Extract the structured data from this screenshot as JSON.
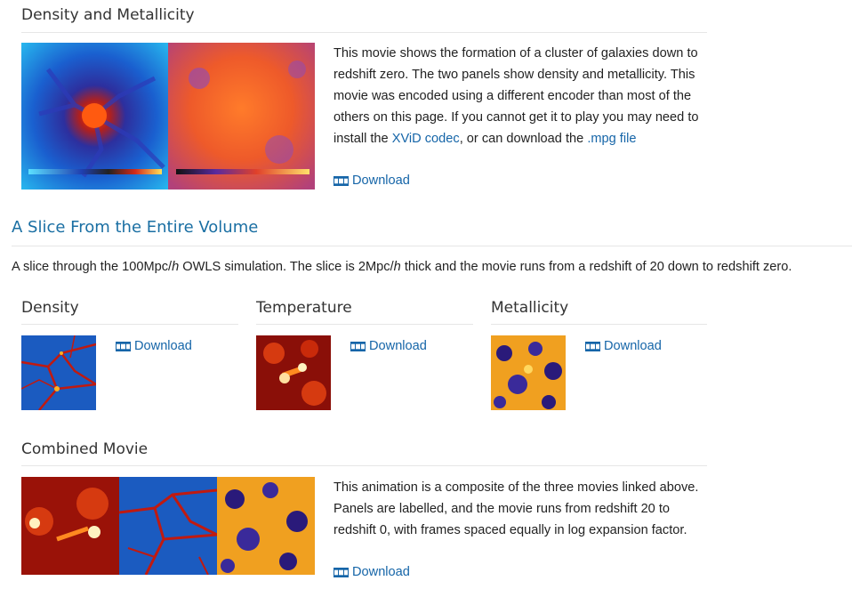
{
  "section1": {
    "title": "Density and Metallicity",
    "para_1": "This movie shows the formation of a cluster of galaxies down to redshift zero. The two panels show density and metallicity. This movie was encoded using a different encoder than most of the others on this page. If you cannot get it to play you may need to install the ",
    "codec_link": "XViD codec",
    "para_2": ", or can download the ",
    "mpg_link": ".mpg file",
    "download": "Download",
    "film-icon": "film-icon"
  },
  "section2": {
    "title": "A Slice From the Entire Volume",
    "intro_a": "A slice through the 100Mpc/",
    "intro_h1": "h",
    "intro_b": " OWLS simulation. The slice is 2Mpc/",
    "intro_h2": "h",
    "intro_c": " thick and the movie runs from a redshift of 20 down to redshift zero."
  },
  "movies": [
    {
      "title": "Density",
      "download": "Download"
    },
    {
      "title": "Temperature",
      "download": "Download"
    },
    {
      "title": "Metallicity",
      "download": "Download"
    }
  ],
  "combined": {
    "title": "Combined Movie",
    "text": "This animation is a composite of the three movies linked above. Panels are labelled, and the movie runs from redshift 20 to redshift 0, with frames spaced equally in log expansion factor.",
    "download": "Download"
  },
  "colors": {
    "link": "#1565a8",
    "heading_blue": "#1a6fa3"
  }
}
